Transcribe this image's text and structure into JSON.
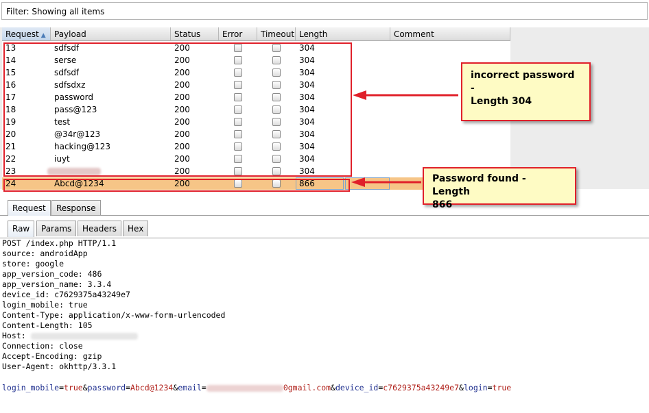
{
  "filter": {
    "text": "Filter: Showing all items"
  },
  "table": {
    "columns": [
      "Request",
      "Payload",
      "Status",
      "Error",
      "Timeout",
      "Length",
      "Comment"
    ],
    "sort_indicator": "▲",
    "rows": [
      {
        "request": "13",
        "payload": "sdfsdf",
        "status": "200",
        "length": "304"
      },
      {
        "request": "14",
        "payload": "serse",
        "status": "200",
        "length": "304"
      },
      {
        "request": "15",
        "payload": "sdfsdf",
        "status": "200",
        "length": "304"
      },
      {
        "request": "16",
        "payload": "sdfsdxz",
        "status": "200",
        "length": "304"
      },
      {
        "request": "17",
        "payload": "password",
        "status": "200",
        "length": "304"
      },
      {
        "request": "18",
        "payload": "pass@123",
        "status": "200",
        "length": "304"
      },
      {
        "request": "19",
        "payload": "test",
        "status": "200",
        "length": "304"
      },
      {
        "request": "20",
        "payload": "@34r@123",
        "status": "200",
        "length": "304"
      },
      {
        "request": "21",
        "payload": "hacking@123",
        "status": "200",
        "length": "304"
      },
      {
        "request": "22",
        "payload": "iuyt",
        "status": "200",
        "length": "304"
      },
      {
        "request": "23",
        "payload": "",
        "status": "200",
        "length": "304"
      },
      {
        "request": "24",
        "payload": "Abcd@1234",
        "status": "200",
        "length": "866"
      }
    ]
  },
  "callouts": {
    "incorrect_line1": "incorrect password -",
    "incorrect_line2": "Length 304",
    "found_line1": "Password found - Length",
    "found_line2": "866"
  },
  "tabs_top": [
    "Request",
    "Response"
  ],
  "tabs_sub": [
    "Raw",
    "Params",
    "Headers",
    "Hex"
  ],
  "raw_request": {
    "lines": [
      "POST /index.php HTTP/1.1",
      "source: androidApp",
      "store: google",
      "app_version_code: 486",
      "app_version_name: 3.3.4",
      "device_id: c7629375a43249e7",
      "login_mobile: true",
      "Content-Type: application/x-www-form-urlencoded",
      "Content-Length: 105",
      "Host: ",
      "Connection: close",
      "Accept-Encoding: gzip",
      "User-Agent: okhttp/3.3.1"
    ],
    "body": {
      "p1_name": "login_mobile",
      "p1_value": "true",
      "p2_name": "password",
      "p2_value": "Abcd@1234",
      "p3_name": "email",
      "p3_value_visible": "0gmail.com",
      "p4_name": "device_id",
      "p4_value": "c7629375a43249e7",
      "p5_name": "login",
      "p5_value": "true"
    }
  },
  "colors": {
    "highlight_red": "#e0202a",
    "callout_bg": "#fefbc4",
    "selected_row": "#f6c587",
    "param_name": "#1f2f8f",
    "param_value": "#b0201a"
  }
}
